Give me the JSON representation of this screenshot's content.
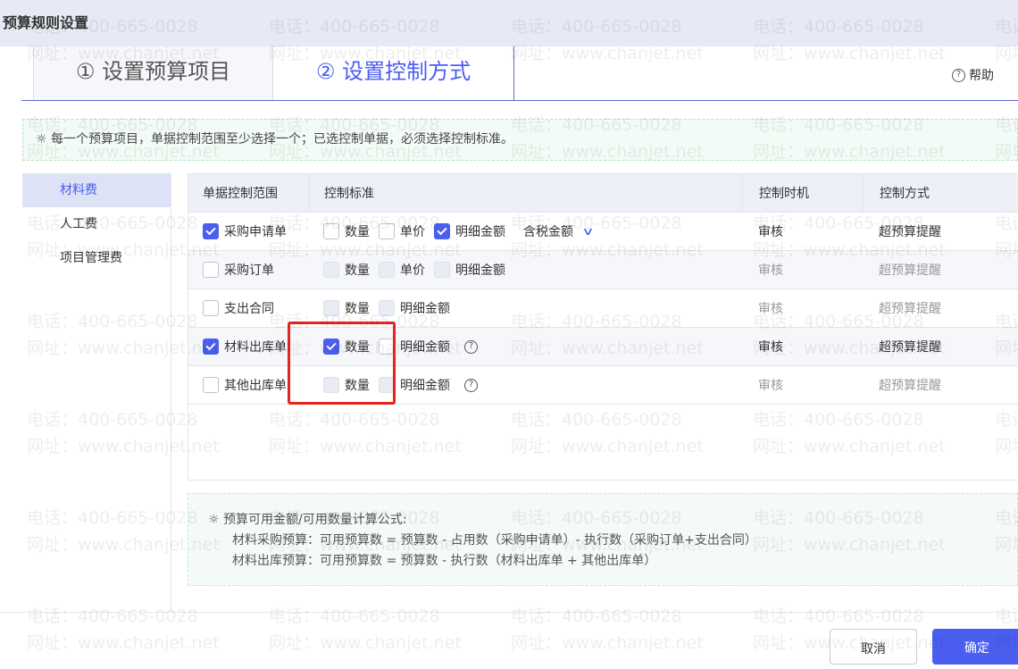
{
  "title": "预算规则设置",
  "tabs": [
    {
      "label": "① 设置预算项目",
      "active": false
    },
    {
      "label": "② 设置控制方式",
      "active": true
    }
  ],
  "help": {
    "label": "帮助",
    "icon": "question-circle-icon"
  },
  "notice": "每一个预算项目，单据控制范围至少选择一个；已选控制单据，必须选择控制标准。",
  "sidebar": {
    "items": [
      {
        "label": "材料费",
        "active": true
      },
      {
        "label": "人工费"
      },
      {
        "label": "项目管理费"
      }
    ]
  },
  "table": {
    "headers": [
      "单据控制范围",
      "控制标准",
      "控制时机",
      "控制方式"
    ],
    "rows": [
      {
        "doc": "采购申请单",
        "checked": true,
        "standards": [
          {
            "label": "数量",
            "checked": false,
            "disabled": false
          },
          {
            "label": "单价",
            "checked": false,
            "disabled": false
          },
          {
            "label": "明细金额",
            "checked": true,
            "disabled": false
          }
        ],
        "select": "含税金额",
        "timing": "审核",
        "method": "超预算提醒"
      },
      {
        "doc": "采购订单",
        "checked": false,
        "standards": [
          {
            "label": "数量",
            "checked": false,
            "disabled": true
          },
          {
            "label": "单价",
            "checked": false,
            "disabled": true
          },
          {
            "label": "明细金额",
            "checked": false,
            "disabled": true
          }
        ],
        "timing": "审核",
        "method": "超预算提醒"
      },
      {
        "doc": "支出合同",
        "checked": false,
        "standards": [
          {
            "label": "数量",
            "checked": false,
            "disabled": true
          },
          {
            "label": "明细金额",
            "checked": false,
            "disabled": true
          }
        ],
        "timing": "审核",
        "method": "超预算提醒"
      },
      {
        "doc": "材料出库单",
        "checked": true,
        "standards": [
          {
            "label": "数量",
            "checked": true,
            "disabled": false
          },
          {
            "label": "明细金额",
            "checked": false,
            "disabled": false
          }
        ],
        "help": true,
        "timing": "审核",
        "method": "超预算提醒"
      },
      {
        "doc": "其他出库单",
        "checked": false,
        "standards": [
          {
            "label": "数量",
            "checked": false,
            "disabled": true
          },
          {
            "label": "明细金额",
            "checked": false,
            "disabled": true
          }
        ],
        "help": true,
        "timing": "审核",
        "method": "超预算提醒"
      }
    ]
  },
  "formula": {
    "title": "预算可用金额/可用数量计算公式:",
    "lines": [
      "材料采购预算：可用预算数 = 预算数 - 占用数（采购申请单）- 执行数（采购订单+支出合同）",
      "材料出库预算：可用预算数 = 预算数 - 执行数（材料出库单 + 其他出库单）"
    ]
  },
  "buttons": {
    "cancel": "取消",
    "ok": "确定"
  },
  "watermark": {
    "phone": "电话：400-665-0028",
    "site": "网址：www.chanjet.net"
  },
  "colors": {
    "accent": "#4a5ef0",
    "highlight": "#e8231e"
  }
}
